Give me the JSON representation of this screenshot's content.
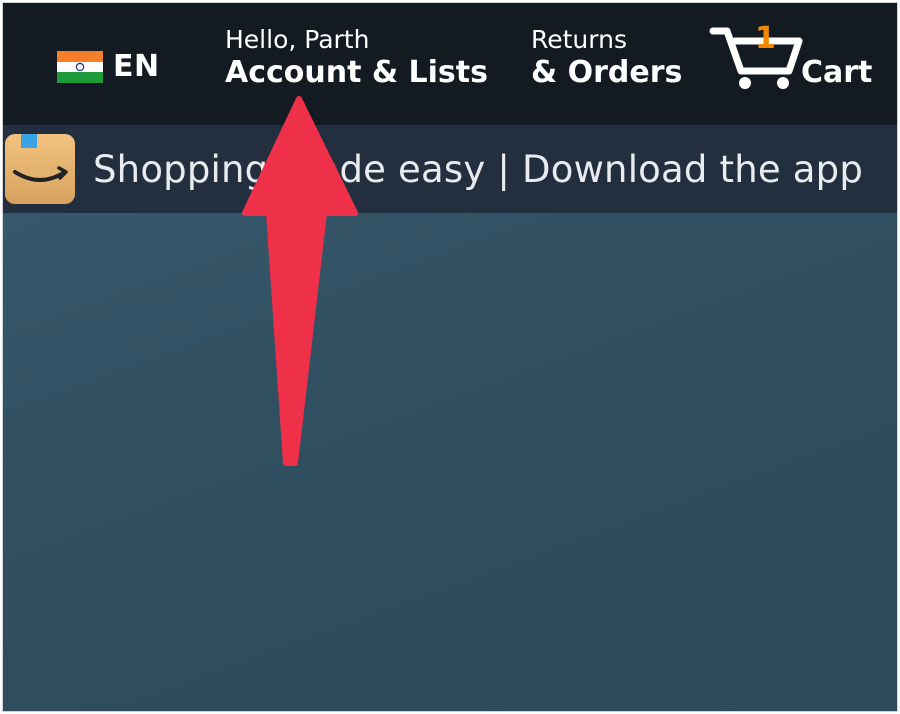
{
  "navbar": {
    "language": {
      "flag": "india-flag-icon",
      "code": "EN"
    },
    "account": {
      "greeting": "Hello, Parth",
      "label": "Account & Lists"
    },
    "orders": {
      "line1": "Returns",
      "line2": "& Orders"
    },
    "cart": {
      "count": "1",
      "label": "Cart",
      "count_color": "#f08804"
    }
  },
  "banner": {
    "logo": "amazon-app-icon",
    "text": "Shopping made easy | Download the app"
  },
  "annotation": {
    "arrow_color": "#ee3048",
    "icon": "red-arrow-annotation"
  },
  "colors": {
    "navbar_bg": "#131a22",
    "banner_bg": "#232f3e"
  }
}
